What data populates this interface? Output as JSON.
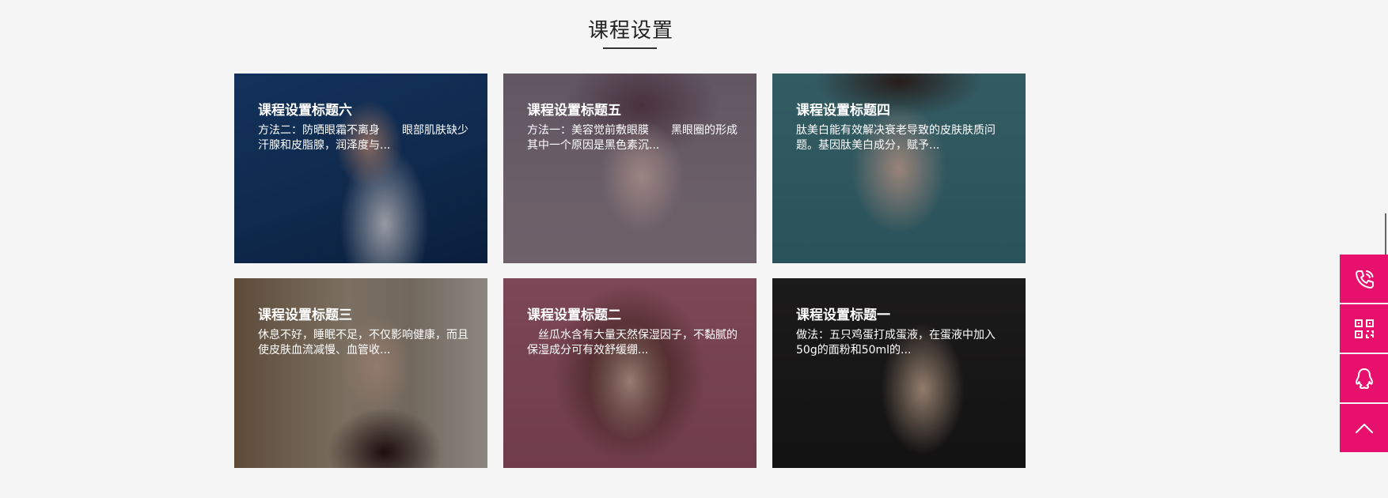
{
  "section": {
    "title": "课程设置"
  },
  "cards": [
    {
      "title": "课程设置标题六",
      "desc": "方法二：防晒眼霜不离身　　眼部肌肤缺少汗腺和皮脂腺，润泽度与..."
    },
    {
      "title": "课程设置标题五",
      "desc": "方法一：美容觉前敷眼膜　　黑眼圈的形成其中一个原因是黑色素沉..."
    },
    {
      "title": "课程设置标题四",
      "desc": "肽美白能有效解决衰老导致的皮肤肤质问题。基因肽美白成分，赋予..."
    },
    {
      "title": "课程设置标题三",
      "desc": "休息不好，睡眠不足，不仅影响健康，而且使皮肤血流减慢、血管收..."
    },
    {
      "title": "课程设置标题二",
      "desc": "　丝瓜水含有大量天然保湿因子，不黏腻的保湿成分可有效舒缓绷..."
    },
    {
      "title": "课程设置标题一",
      "desc": "做法：五只鸡蛋打成蛋液，在蛋液中加入50g的面粉和50ml的..."
    }
  ],
  "sidebar_buttons": [
    {
      "icon": "phone-icon"
    },
    {
      "icon": "qrcode-icon"
    },
    {
      "icon": "qq-icon"
    },
    {
      "icon": "chevron-up-icon"
    }
  ],
  "colors": {
    "accent": "#e8106d",
    "background": "#f5f5f5"
  }
}
